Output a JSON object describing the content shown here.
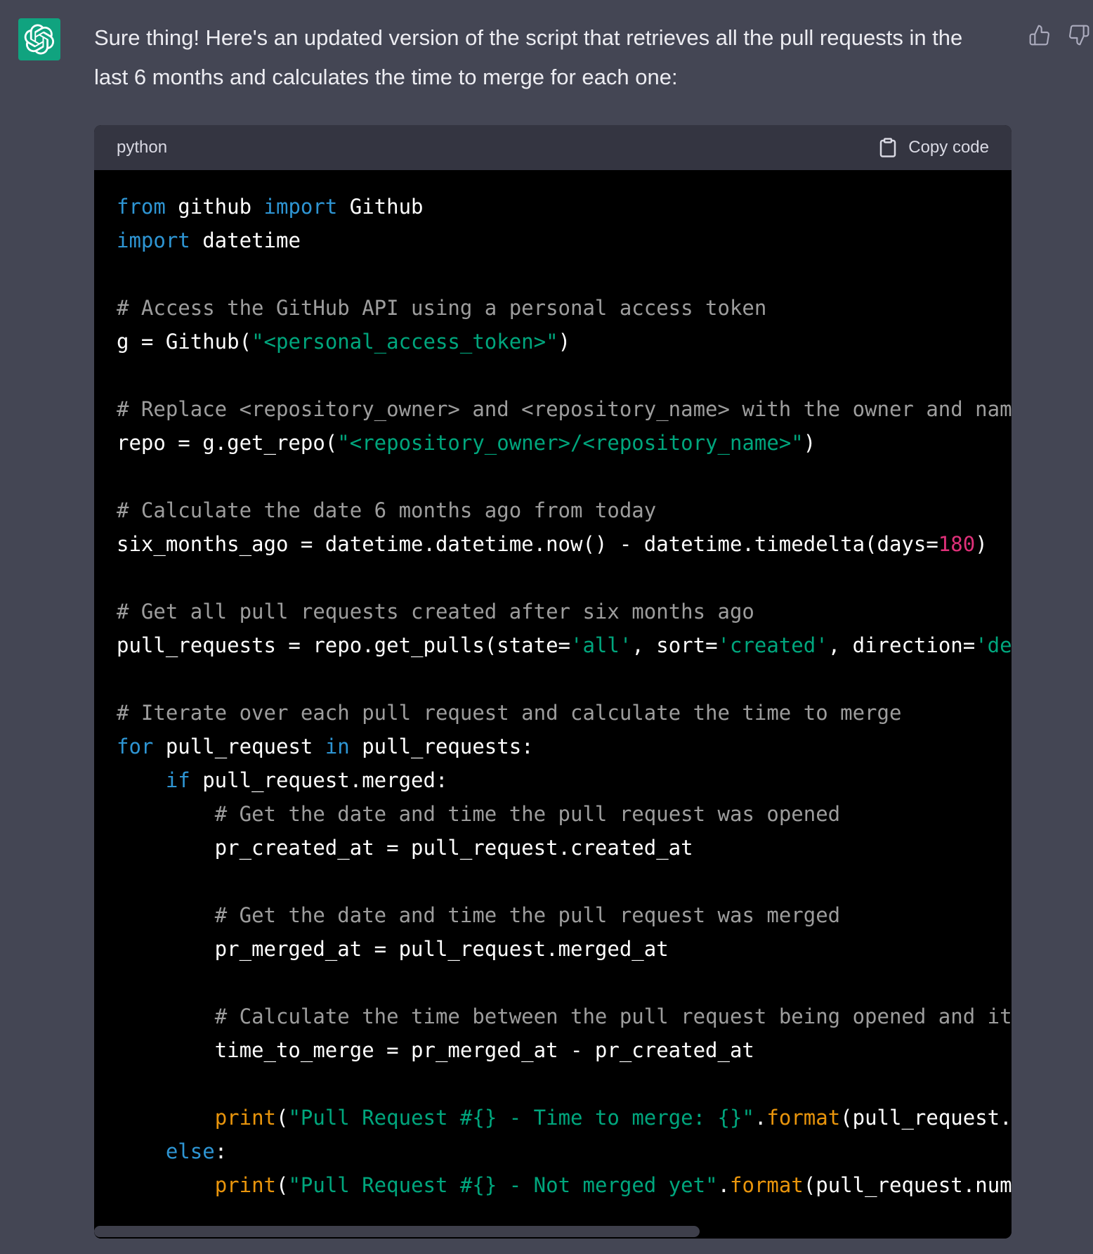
{
  "message": {
    "text": "Sure thing! Here's an updated version of the script that retrieves all the pull requests in the last 6 months and calculates the time to merge for each one:"
  },
  "code_block": {
    "language": "python",
    "copy_label": "Copy code",
    "lines": [
      [
        {
          "t": "from",
          "c": "kw"
        },
        {
          "t": " github "
        },
        {
          "t": "import",
          "c": "kw"
        },
        {
          "t": " Github"
        }
      ],
      [
        {
          "t": "import",
          "c": "kw"
        },
        {
          "t": " datetime"
        }
      ],
      [],
      [
        {
          "t": "# Access the GitHub API using a personal access token",
          "c": "cm"
        }
      ],
      [
        {
          "t": "g = Github("
        },
        {
          "t": "\"<personal_access_token>\"",
          "c": "str"
        },
        {
          "t": ")"
        }
      ],
      [],
      [
        {
          "t": "# Replace <repository_owner> and <repository_name> with the owner and name o",
          "c": "cm"
        }
      ],
      [
        {
          "t": "repo = g.get_repo("
        },
        {
          "t": "\"<repository_owner>/<repository_name>\"",
          "c": "str"
        },
        {
          "t": ")"
        }
      ],
      [],
      [
        {
          "t": "# Calculate the date 6 months ago from today",
          "c": "cm"
        }
      ],
      [
        {
          "t": "six_months_ago = datetime.datetime.now() - datetime.timedelta(days="
        },
        {
          "t": "180",
          "c": "num"
        },
        {
          "t": ")"
        }
      ],
      [],
      [
        {
          "t": "# Get all pull requests created after six months ago",
          "c": "cm"
        }
      ],
      [
        {
          "t": "pull_requests = repo.get_pulls(state="
        },
        {
          "t": "'all'",
          "c": "str"
        },
        {
          "t": ", sort="
        },
        {
          "t": "'created'",
          "c": "str"
        },
        {
          "t": ", direction="
        },
        {
          "t": "'desc'",
          "c": "str"
        }
      ],
      [],
      [
        {
          "t": "# Iterate over each pull request and calculate the time to merge",
          "c": "cm"
        }
      ],
      [
        {
          "t": "for",
          "c": "kw"
        },
        {
          "t": " pull_request "
        },
        {
          "t": "in",
          "c": "kw"
        },
        {
          "t": " pull_requests:"
        }
      ],
      [
        {
          "t": "    "
        },
        {
          "t": "if",
          "c": "kw"
        },
        {
          "t": " pull_request.merged:"
        }
      ],
      [
        {
          "t": "        "
        },
        {
          "t": "# Get the date and time the pull request was opened",
          "c": "cm"
        }
      ],
      [
        {
          "t": "        pr_created_at = pull_request.created_at"
        }
      ],
      [],
      [
        {
          "t": "        "
        },
        {
          "t": "# Get the date and time the pull request was merged",
          "c": "cm"
        }
      ],
      [
        {
          "t": "        pr_merged_at = pull_request.merged_at"
        }
      ],
      [],
      [
        {
          "t": "        "
        },
        {
          "t": "# Calculate the time between the pull request being opened and it be",
          "c": "cm"
        }
      ],
      [
        {
          "t": "        time_to_merge = pr_merged_at - pr_created_at"
        }
      ],
      [],
      [
        {
          "t": "        "
        },
        {
          "t": "print",
          "c": "fn"
        },
        {
          "t": "("
        },
        {
          "t": "\"Pull Request #{} - Time to merge: {}\"",
          "c": "str"
        },
        {
          "t": "."
        },
        {
          "t": "format",
          "c": "fn"
        },
        {
          "t": "(pull_request.num"
        }
      ],
      [
        {
          "t": "    "
        },
        {
          "t": "else",
          "c": "kw"
        },
        {
          "t": ":"
        }
      ],
      [
        {
          "t": "        "
        },
        {
          "t": "print",
          "c": "fn"
        },
        {
          "t": "("
        },
        {
          "t": "\"Pull Request #{} - Not merged yet\"",
          "c": "str"
        },
        {
          "t": "."
        },
        {
          "t": "format",
          "c": "fn"
        },
        {
          "t": "(pull_request.number"
        }
      ]
    ]
  },
  "icons": {
    "avatar": "openai-logo-icon",
    "thumbs_up": "thumbs-up-icon",
    "thumbs_down": "thumbs-down-icon",
    "copy": "clipboard-icon"
  },
  "colors": {
    "background": "#444654",
    "code_header": "#343541",
    "code_bg": "#000000",
    "keyword": "#2e95d3",
    "comment": "#9d9d9d",
    "string": "#00a67d",
    "number": "#df3079",
    "function": "#e9950c",
    "avatar_bg": "#10a37f"
  },
  "scrollbar": {
    "position_fraction": 0.0,
    "visible_fraction": 0.66
  }
}
